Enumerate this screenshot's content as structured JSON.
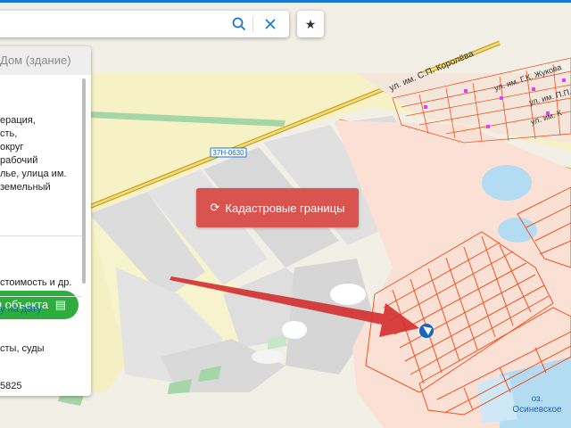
{
  "search": {
    "search_icon": "search-icon",
    "clear_icon": "close-icon"
  },
  "favorite_icon": "star-icon",
  "panel": {
    "header": "Дом (здание)",
    "address_lines": [
      "ерация,",
      "сть,",
      "округ",
      "рабочий",
      "лье, улица им.",
      "земельный"
    ],
    "object_button": "и объекта",
    "cost_text": "стоимость и др.",
    "date_link": "у на дату",
    "courts_text": "сты, суды",
    "number_text": "5825"
  },
  "map": {
    "cadastral_button": "Кадастровые границы",
    "road_label": "37Н-0630",
    "street_korolev": "ул. им. С.П. Королёва",
    "street_zhukov": "ул. им. Г.К. Жукова",
    "street_pp": "ул. им. П.П.",
    "street_r": "ул. им. К",
    "lake_label_1": "оз.",
    "lake_label_2": "Осиневское"
  },
  "colors": {
    "accent_blue": "#1976d2",
    "cadastral_red": "#d9534f",
    "green_button": "#2eac3e",
    "parcel_outline": "#f4511e",
    "road": "#c9a227"
  }
}
